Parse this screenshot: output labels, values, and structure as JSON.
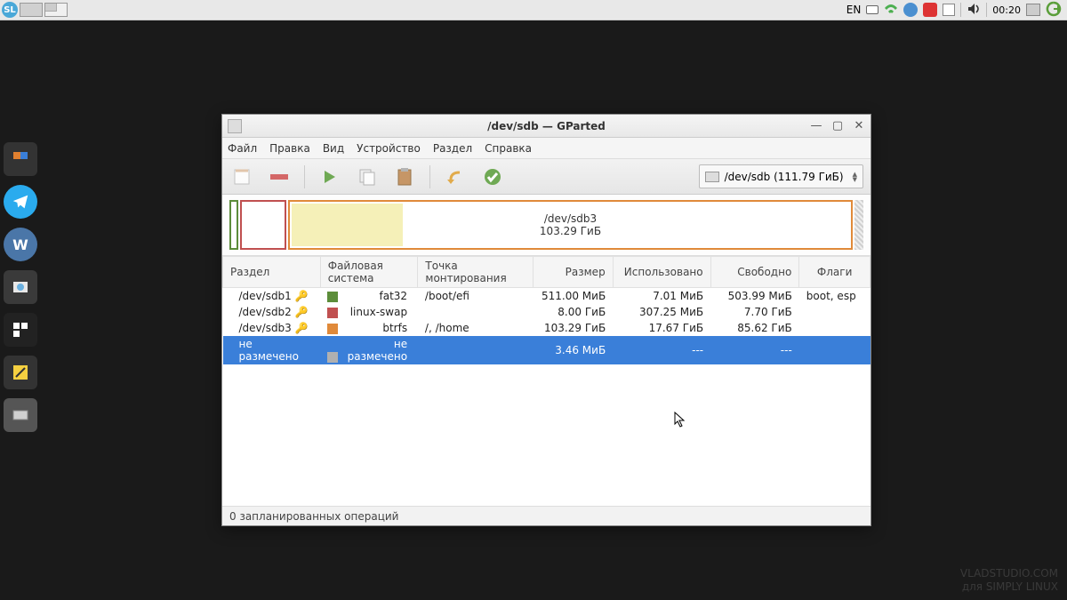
{
  "panel": {
    "lang": "EN",
    "clock": "00:20"
  },
  "watermark": {
    "line1": "VLADSTUDIO.COM",
    "line2": "для SIMPLY LINUX"
  },
  "window": {
    "title": "/dev/sdb — GParted",
    "device_selector": "/dev/sdb (111.79 ГиБ)",
    "menu": {
      "file": "Файл",
      "edit": "Правка",
      "view": "Вид",
      "device": "Устройство",
      "partition": "Раздел",
      "help": "Справка"
    },
    "map": {
      "label_name": "/dev/sdb3",
      "label_size": "103.29 ГиБ"
    },
    "columns": {
      "partition": "Раздел",
      "fs": "Файловая система",
      "mount": "Точка монтирования",
      "size": "Размер",
      "used": "Использовано",
      "free": "Свободно",
      "flags": "Флаги"
    },
    "rows": [
      {
        "partition": "/dev/sdb1",
        "fs": "fat32",
        "mount": "/boot/efi",
        "size": "511.00 МиБ",
        "used": "7.01 МиБ",
        "free": "503.99 МиБ",
        "flags": "boot, esp",
        "selected": false,
        "locked": true
      },
      {
        "partition": "/dev/sdb2",
        "fs": "linux-swap",
        "mount": "",
        "size": "8.00 ГиБ",
        "used": "307.25 МиБ",
        "free": "7.70 ГиБ",
        "flags": "",
        "selected": false,
        "locked": true
      },
      {
        "partition": "/dev/sdb3",
        "fs": "btrfs",
        "mount": "/, /home",
        "size": "103.29 ГиБ",
        "used": "17.67 ГиБ",
        "free": "85.62 ГиБ",
        "flags": "",
        "selected": false,
        "locked": true
      },
      {
        "partition": "не размечено",
        "fs": "не размечено",
        "mount": "",
        "size": "3.46 МиБ",
        "used": "---",
        "free": "---",
        "flags": "",
        "selected": true,
        "locked": false
      }
    ],
    "status": "0 запланированных операций"
  }
}
